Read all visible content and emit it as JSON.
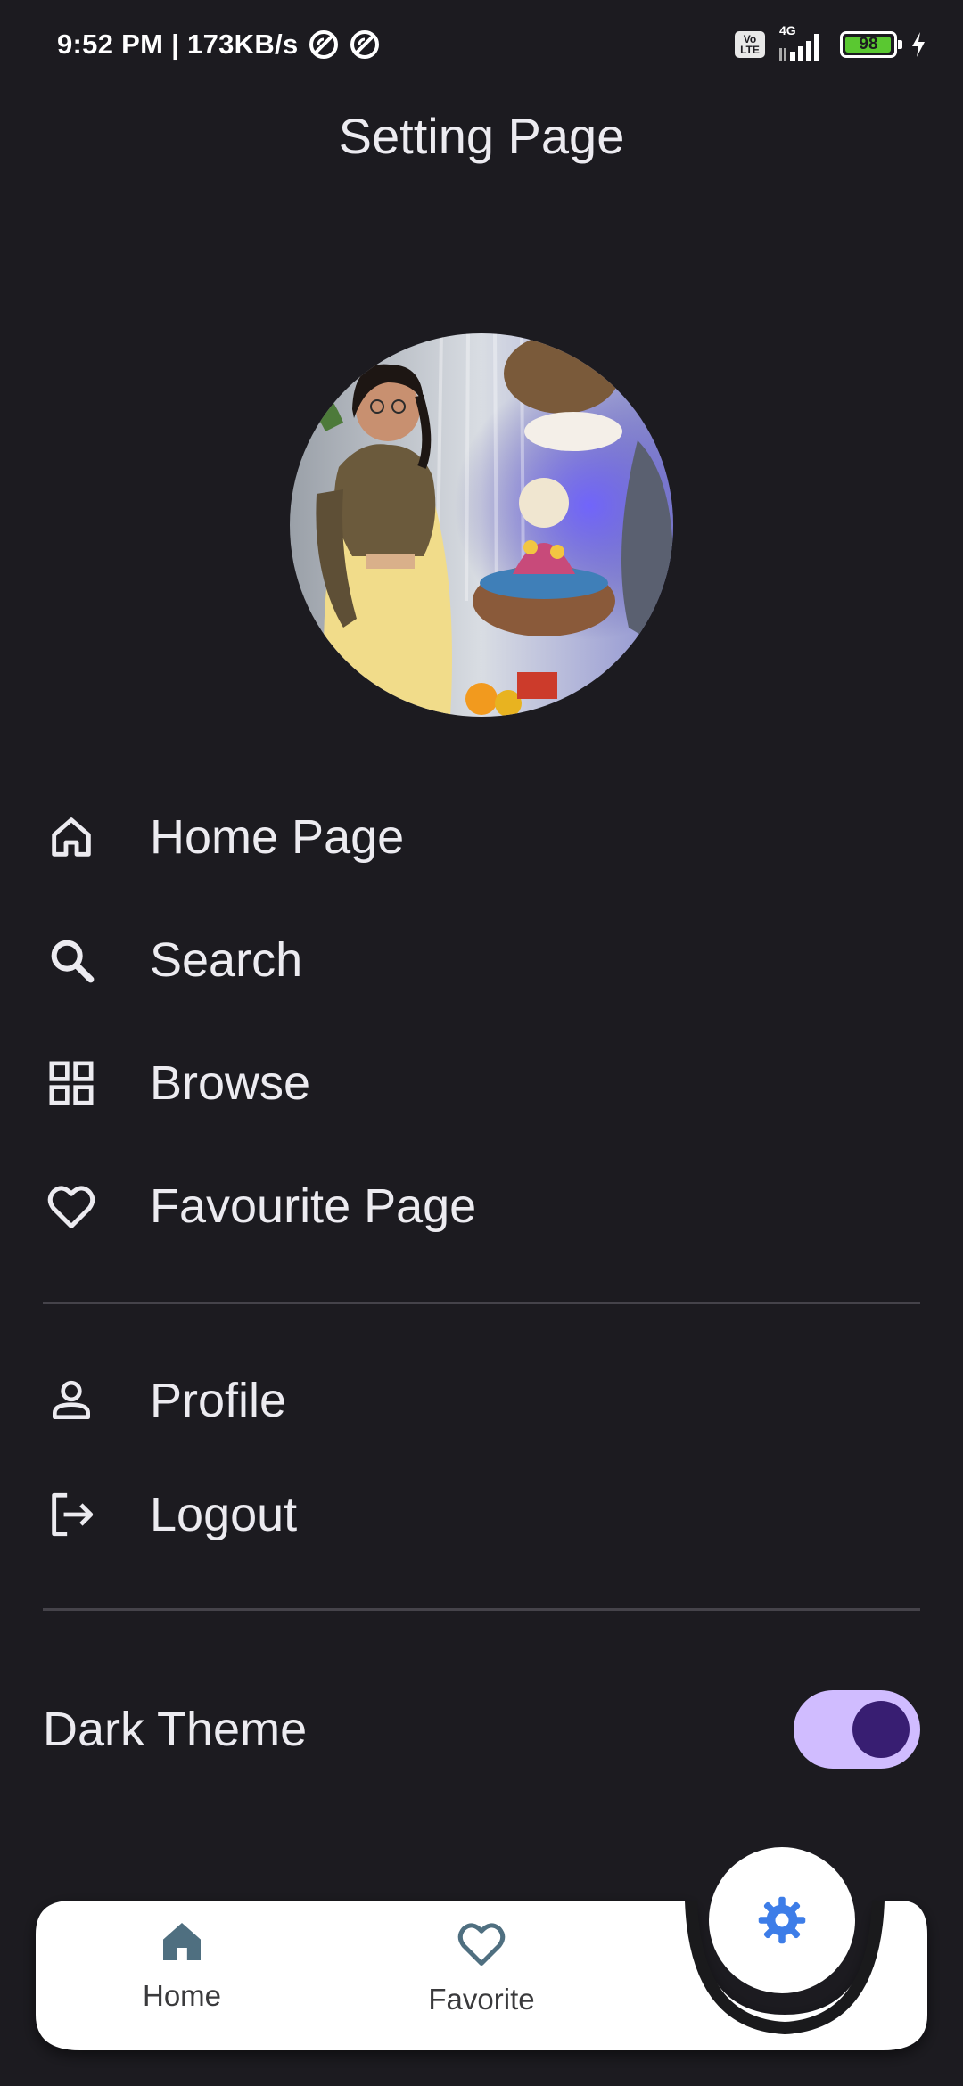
{
  "status_bar": {
    "time_speed": "9:52 PM | 173KB/s",
    "volte": "Vo LTE",
    "network": "4G",
    "battery": "98",
    "battery_level": 0.98
  },
  "page": {
    "title": "Setting Page"
  },
  "profile": {
    "avatar_alt": "profile-photo"
  },
  "menu": {
    "primary": [
      {
        "label": "Home Page",
        "icon": "home-icon"
      },
      {
        "label": "Search",
        "icon": "search-icon"
      },
      {
        "label": "Browse",
        "icon": "grid-icon"
      },
      {
        "label": "Favourite Page",
        "icon": "heart-icon"
      }
    ],
    "secondary": [
      {
        "label": "Profile",
        "icon": "person-icon"
      },
      {
        "label": "Logout",
        "icon": "logout-icon"
      }
    ]
  },
  "theme": {
    "label": "Dark Theme",
    "enabled": true
  },
  "bottom_nav": {
    "items": [
      {
        "label": "Home",
        "icon": "home-filled-icon"
      },
      {
        "label": "Favorite",
        "icon": "heart-outline-icon"
      }
    ],
    "fab_icon": "gear-icon"
  },
  "colors": {
    "background": "#1c1b20",
    "text": "#ecebf0",
    "toggle_track": "#d0bcff",
    "toggle_knob": "#381e72",
    "nav_background": "#ffffff",
    "nav_icon": "#4f6f80",
    "fab_icon": "#3d7de8"
  }
}
